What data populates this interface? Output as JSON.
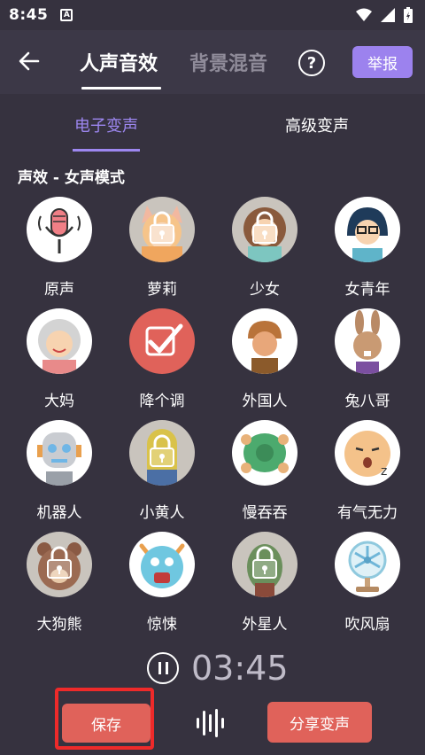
{
  "status_bar": {
    "time": "8:45",
    "notification_badge": "A"
  },
  "header": {
    "tabs": [
      {
        "label": "人声音效",
        "active": true
      },
      {
        "label": "背景混音",
        "active": false
      }
    ],
    "help_label": "?",
    "report_label": "举报"
  },
  "subtabs": [
    {
      "label": "电子变声",
      "active": true
    },
    {
      "label": "高级变声",
      "active": false
    }
  ],
  "section_title": "声效 - 女声模式",
  "effects": [
    {
      "label": "原声",
      "icon": "microphone-icon",
      "locked": false
    },
    {
      "label": "萝莉",
      "icon": "loli-girl-icon",
      "locked": true
    },
    {
      "label": "少女",
      "icon": "young-girl-icon",
      "locked": true
    },
    {
      "label": "女青年",
      "icon": "young-woman-icon",
      "locked": false
    },
    {
      "label": "大妈",
      "icon": "old-lady-icon",
      "locked": false
    },
    {
      "label": "降个调",
      "icon": "checkmark-icon",
      "locked": false,
      "selected": true
    },
    {
      "label": "外国人",
      "icon": "foreigner-icon",
      "locked": false
    },
    {
      "label": "兔八哥",
      "icon": "rabbit-icon",
      "locked": false
    },
    {
      "label": "机器人",
      "icon": "robot-icon",
      "locked": false
    },
    {
      "label": "小黄人",
      "icon": "minion-icon",
      "locked": true
    },
    {
      "label": "慢吞吞",
      "icon": "turtle-icon",
      "locked": false
    },
    {
      "label": "有气无力",
      "icon": "sleepy-face-icon",
      "locked": false
    },
    {
      "label": "大狗熊",
      "icon": "bear-icon",
      "locked": true
    },
    {
      "label": "惊悚",
      "icon": "monster-icon",
      "locked": false
    },
    {
      "label": "外星人",
      "icon": "alien-icon",
      "locked": true
    },
    {
      "label": "吹风扇",
      "icon": "fan-icon",
      "locked": false
    }
  ],
  "player": {
    "time": "03:45"
  },
  "actions": {
    "save_label": "保存",
    "share_label": "分享变声"
  },
  "colors": {
    "background": "#36323f",
    "accent": "#9d87f0",
    "button": "#e0625a"
  }
}
